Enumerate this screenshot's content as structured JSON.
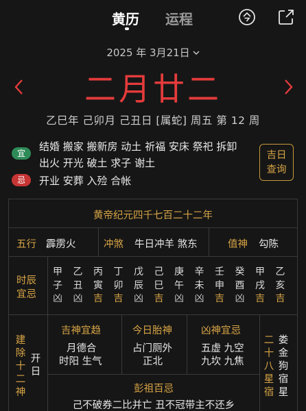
{
  "header": {
    "tab_active": "黄历",
    "tab_inactive": "运程",
    "icon_left": "ling-icon",
    "icon_right": "share-icon"
  },
  "date": {
    "label": "2025 年 3月21日"
  },
  "lunar": {
    "day": "二月廿二",
    "ganzhi": "乙巳年 己卯月 己丑日 [属蛇] 周五  第 12 周"
  },
  "yi": {
    "badge": "宜",
    "line1": "结婚 搬家 搬新房 动土 祈福 安床 祭祀 拆卸",
    "line2": "出火 开光 破土 求子 谢土"
  },
  "ji": {
    "badge": "忌",
    "line1": "开业 安葬 入殓 合帐"
  },
  "query_button": {
    "line1": "吉日",
    "line2": "查询"
  },
  "panel": {
    "era": "黄帝纪元四千七百二十二年",
    "wuxing_label": "五行",
    "wuxing_value": "霹雳火",
    "chongsha_label": "冲煞",
    "chongsha_value": "牛日冲羊 煞东",
    "zhishen_label": "值神",
    "zhishen_value": "勾陈",
    "shichen_label_1": "时辰",
    "shichen_label_2": "宜忌",
    "hours": [
      {
        "top": "甲",
        "mid": "子",
        "status": "凶"
      },
      {
        "top": "乙",
        "mid": "丑",
        "status": "凶"
      },
      {
        "top": "丙",
        "mid": "寅",
        "status": "吉"
      },
      {
        "top": "丁",
        "mid": "卯",
        "status": "吉"
      },
      {
        "top": "戊",
        "mid": "辰",
        "status": "凶"
      },
      {
        "top": "己",
        "mid": "巳",
        "status": "吉"
      },
      {
        "top": "庚",
        "mid": "午",
        "status": "凶"
      },
      {
        "top": "辛",
        "mid": "未",
        "status": "凶"
      },
      {
        "top": "壬",
        "mid": "申",
        "status": "吉"
      },
      {
        "top": "癸",
        "mid": "酉",
        "status": "凶"
      },
      {
        "top": "甲",
        "mid": "戌",
        "status": "吉"
      },
      {
        "top": "乙",
        "mid": "亥",
        "status": "吉"
      }
    ],
    "jianchu_label": [
      "建",
      "除",
      "十",
      "二",
      "神"
    ],
    "jianchu_value": [
      "开",
      "日"
    ],
    "jishen_label": "吉神宜趋",
    "jishen_line1": "月德合",
    "jishen_line2": "时阳 生气",
    "taishen_label": "今日胎神",
    "taishen_line1": "占门厕外",
    "taishen_line2": "正北",
    "xiongshen_label": "凶神宜忌",
    "xiongshen_line1": "五虚 九空",
    "xiongshen_line2": "九坎 九焦",
    "xiu_label": [
      "二",
      "十",
      "八",
      "星",
      "宿"
    ],
    "xiu_value": [
      "娄",
      "金",
      "狗",
      "宿",
      "星"
    ],
    "pengzu_label": "彭祖百忌",
    "pengzu_value": "己不破券二比并亡 丑不冠带主不还乡"
  }
}
